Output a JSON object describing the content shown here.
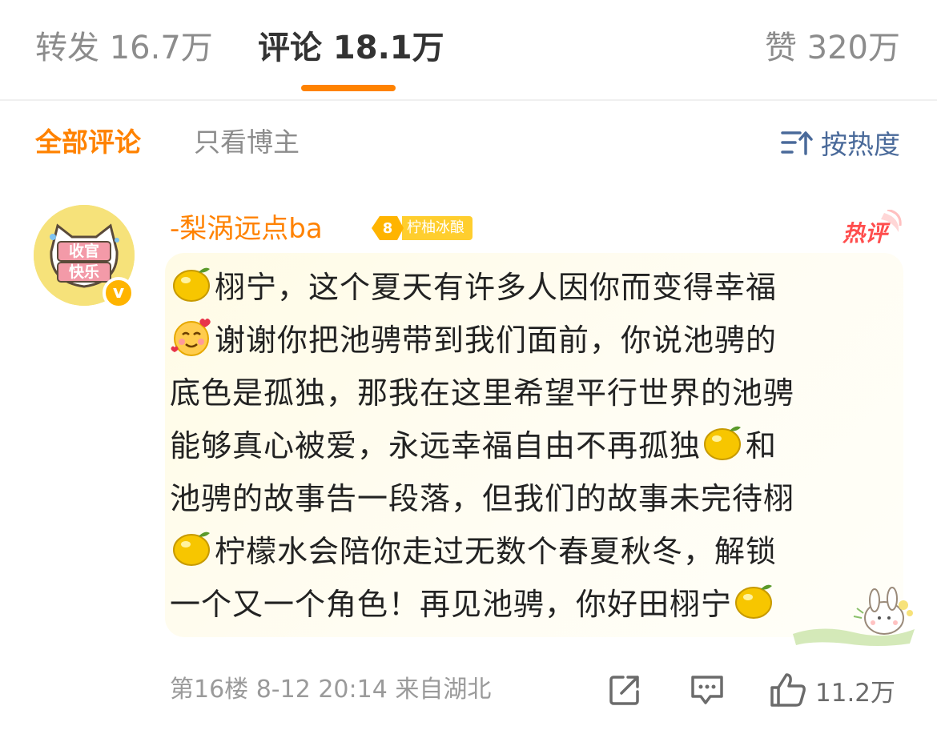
{
  "tabs": {
    "reposts": "转发 16.7万",
    "comments": "评论 18.1万",
    "likes": "赞 320万"
  },
  "filters": {
    "all": "全部评论",
    "author_only": "只看博主",
    "sort": "按热度"
  },
  "comment": {
    "username": "-梨涡远点ba",
    "fan_level": "8",
    "fan_group": "柠柚冰酿",
    "hot_label": "热评",
    "avatar_text": [
      "收官",
      "快乐"
    ],
    "lines": [
      "栩宁，这个夏天有许多人因你而变得幸福",
      "谢谢你把池骋带到我们面前，你说池骋的",
      "底色是孤独，那我在这里希望平行世界的池骋",
      "能够真心被爱，永远幸福自由不再孤独",
      "和",
      "池骋的故事告一段落，但我们的故事未完待栩",
      "柠檬水会陪你走过无数个春夏秋冬，解锁",
      "一个又一个角色！再见池骋，你好田栩宁"
    ],
    "meta": "第16楼  8-12 20:14  来自湖北",
    "like_count": "11.2万"
  },
  "colors": {
    "accent": "#ff8200",
    "link": "#4a6a9a",
    "hot": "#ff4e4e",
    "bubble": "#fffbe6"
  },
  "icons": [
    "sort-icon",
    "lemon-icon",
    "smiling-hearts-icon",
    "forward-icon",
    "comment-icon",
    "like-icon",
    "verified-icon"
  ]
}
